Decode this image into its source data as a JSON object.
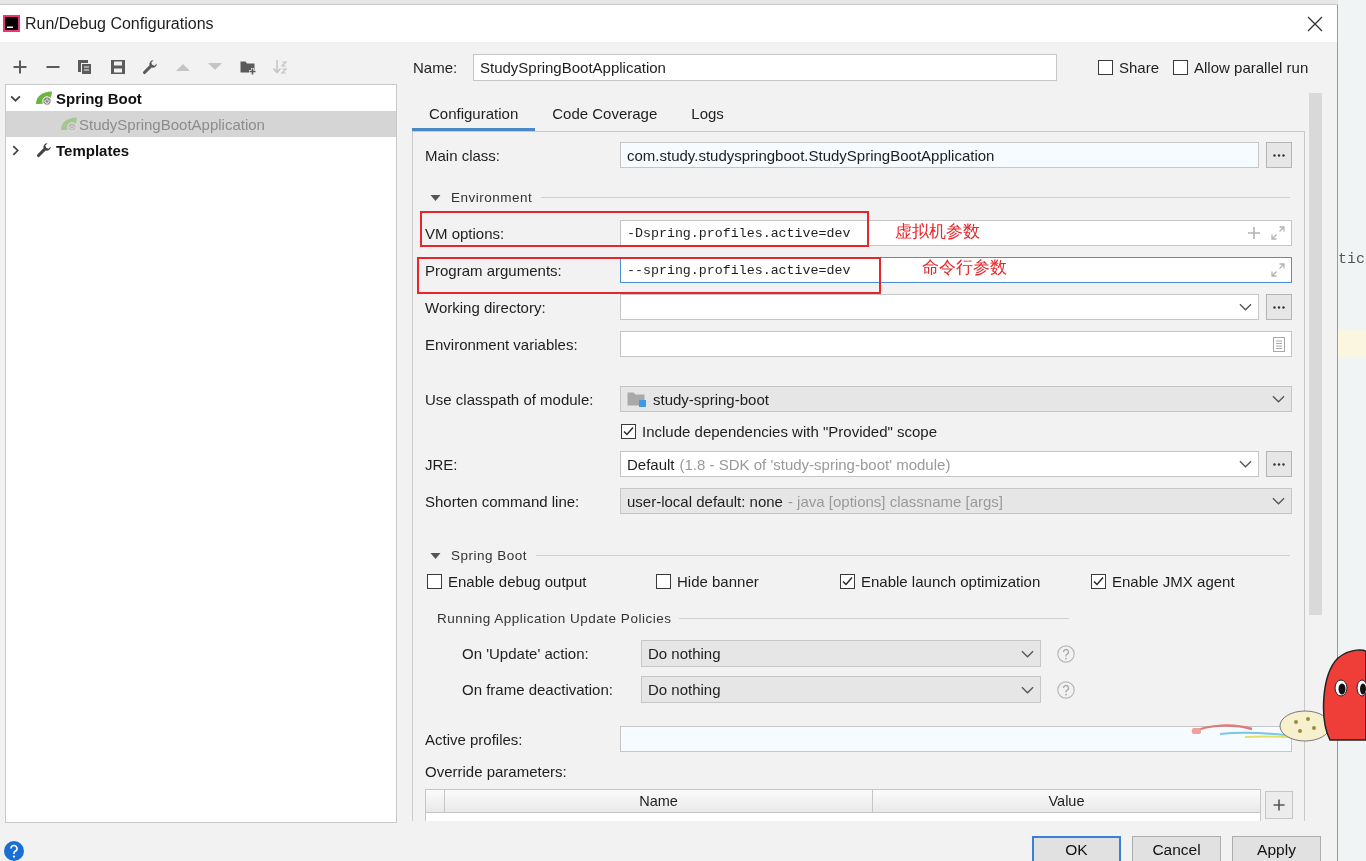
{
  "window": {
    "title": "Run/Debug Configurations"
  },
  "editor": {
    "visible_text": "tic"
  },
  "toolbar": [
    {
      "kind": "add",
      "disabled": false
    },
    {
      "kind": "remove",
      "disabled": false
    },
    {
      "kind": "copy",
      "disabled": false
    },
    {
      "kind": "save",
      "disabled": false
    },
    {
      "kind": "edit_defaults",
      "disabled": false
    },
    {
      "kind": "move_up",
      "disabled": true
    },
    {
      "kind": "move_down",
      "disabled": true
    },
    {
      "kind": "new_folder",
      "disabled": false
    },
    {
      "kind": "sort",
      "disabled": true
    }
  ],
  "tree": [
    {
      "label": "Spring Boot",
      "kind": "spring",
      "expanded": true,
      "selected": false,
      "temporary": false,
      "children": [
        {
          "label": "StudySpringBootApplication",
          "kind": "spring",
          "selected": true,
          "temporary": true
        }
      ]
    },
    {
      "label": "Templates",
      "kind": "templates",
      "expanded": false,
      "selected": false,
      "temporary": false
    }
  ],
  "name_field": {
    "label": "Name:",
    "value": "StudySpringBootApplication"
  },
  "options": [
    {
      "label": "Share",
      "checked": false
    },
    {
      "label": "Allow parallel run",
      "checked": false
    }
  ],
  "tabs": [
    {
      "label": "Configuration",
      "selected": true
    },
    {
      "label": "Code Coverage",
      "selected": false
    },
    {
      "label": "Logs",
      "selected": false
    }
  ],
  "main_class": {
    "label": "Main class:",
    "value": "com.study.studyspringboot.StudySpringBootApplication"
  },
  "environment": {
    "title": "Environment",
    "expanded": true,
    "fields": [
      {
        "kind": "macro_text",
        "label": "VM options:",
        "value": "-Dspring.profiles.active=dev",
        "focused": false,
        "annotation": "虚拟机参数"
      },
      {
        "kind": "expand_text",
        "label": "Program arguments:",
        "value": "--spring.profiles.active=dev",
        "focused": true,
        "annotation": "命令行参数"
      },
      {
        "kind": "path",
        "label": "Working directory:",
        "focused": false
      },
      {
        "kind": "env",
        "label": "Environment variables:",
        "focused": false
      }
    ]
  },
  "module": {
    "label": "Use classpath of module:",
    "value": "study-spring-boot"
  },
  "include_provided": {
    "label": "Include dependencies with \"Provided\" scope",
    "checked": true
  },
  "jre": {
    "label": "JRE:",
    "value": "Default",
    "detail": "(1.8 - SDK of 'study-spring-boot' module)"
  },
  "shorten_command_line": {
    "label": "Shorten command line:",
    "value": "user-local default: none",
    "detail": "- java [options] classname [args]"
  },
  "spring_boot": {
    "title": "Spring Boot",
    "expanded": true,
    "checkboxes": [
      {
        "label": "Enable debug output",
        "checked": false
      },
      {
        "label": "Hide banner",
        "checked": false
      },
      {
        "label": "Enable launch optimization",
        "checked": true
      },
      {
        "label": "Enable JMX agent",
        "checked": true
      }
    ],
    "update_policies": {
      "title": "Running Application Update Policies",
      "rows": [
        {
          "label": "On 'Update' action:",
          "value": "Do nothing"
        },
        {
          "label": "On frame deactivation:",
          "value": "Do nothing"
        }
      ]
    },
    "active_profiles": {
      "label": "Active profiles:"
    },
    "override_parameters": {
      "label": "Override parameters:",
      "columns": [
        "Name",
        "Value"
      ]
    }
  },
  "buttons": [
    {
      "label": "OK",
      "default": true
    },
    {
      "label": "Cancel",
      "default": false
    },
    {
      "label": "Apply",
      "default": false
    }
  ]
}
